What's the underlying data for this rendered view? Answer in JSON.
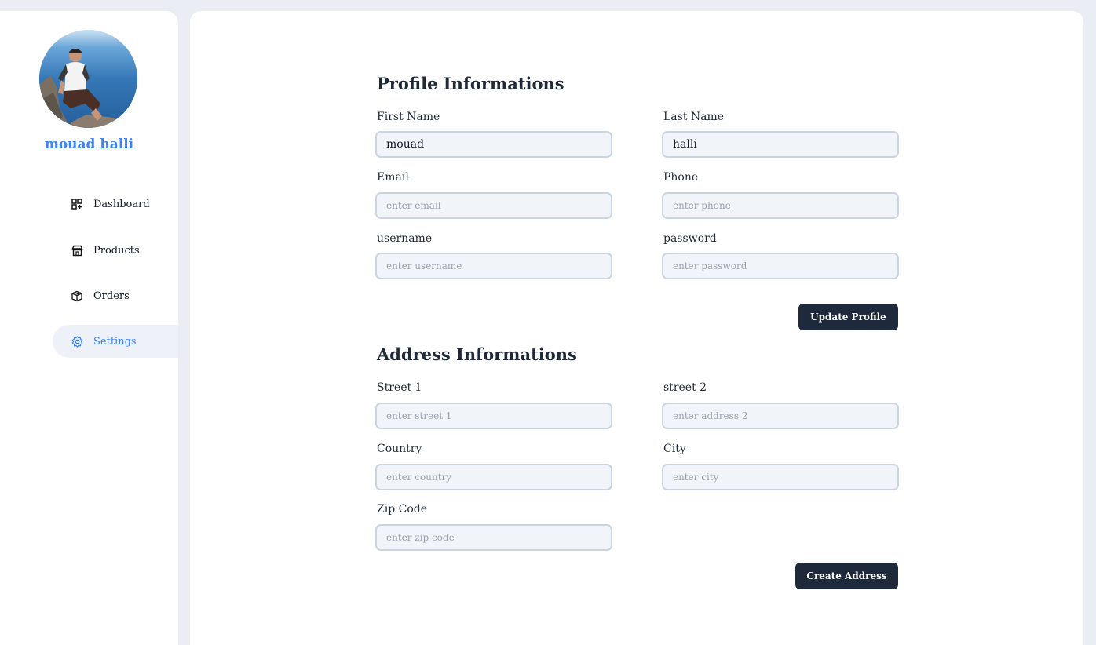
{
  "user": {
    "name": "mouad halli"
  },
  "sidebar": {
    "items": [
      {
        "label": "Dashboard",
        "icon": "dashboard-icon"
      },
      {
        "label": "Products",
        "icon": "store-icon"
      },
      {
        "label": "Orders",
        "icon": "box-icon"
      },
      {
        "label": "Settings",
        "icon": "gear-icon",
        "active": true
      }
    ]
  },
  "profile": {
    "title": "Profile Informations",
    "first_name": {
      "label": "First Name",
      "value": "mouad"
    },
    "last_name": {
      "label": "Last Name",
      "value": "halli"
    },
    "email": {
      "label": "Email",
      "placeholder": "enter email"
    },
    "phone": {
      "label": "Phone",
      "placeholder": "enter phone"
    },
    "username": {
      "label": "username",
      "placeholder": "enter username"
    },
    "password": {
      "label": "password",
      "placeholder": "enter password"
    },
    "submit_label": "Update Profile"
  },
  "address": {
    "title": "Address Informations",
    "street1": {
      "label": "Street 1",
      "placeholder": "enter street 1"
    },
    "street2": {
      "label": "street 2",
      "placeholder": "enter address 2"
    },
    "country": {
      "label": "Country",
      "placeholder": "enter country"
    },
    "city": {
      "label": "City",
      "placeholder": "enter city"
    },
    "zip": {
      "label": "Zip Code",
      "placeholder": "enter zip code"
    },
    "submit_label": "Create Address"
  },
  "colors": {
    "accent": "#3b82f6",
    "button": "#1e293b",
    "page_bg": "#eaeef4",
    "input_bg": "#f1f4f9",
    "input_border": "#cbd5e1"
  }
}
